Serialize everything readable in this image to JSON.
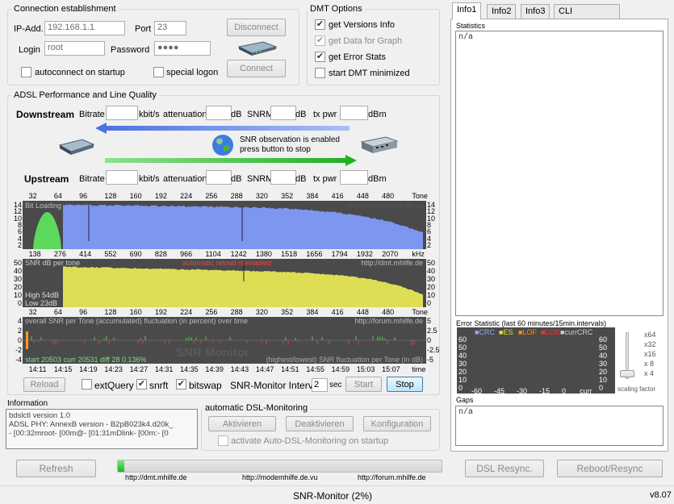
{
  "connection": {
    "title": "Connection establishment",
    "ip_label": "IP-Add.",
    "ip_value": "192.168.1.1",
    "port_label": "Port",
    "port_value": "23",
    "login_label": "Login",
    "login_value": "root",
    "password_label": "Password",
    "password_value": "●●●●",
    "disconnect": "Disconnect",
    "connect": "Connect",
    "autoconnect": "autoconnect on startup",
    "special": "special logon"
  },
  "dmt": {
    "title": "DMT Options",
    "opt1": "get Versions Info",
    "opt2": "get Data for Graph",
    "opt3": "get Error Stats",
    "opt4": "start DMT minimized"
  },
  "adsl": {
    "title": "ADSL Performance and Line Quality",
    "downstream": "Downstream",
    "upstream": "Upstream",
    "bitrate": "Bitrate",
    "kbits": "kbit/s",
    "attenuation": "attenuation",
    "db": "dB",
    "snrm": "SNRM",
    "txpwr": "tx pwr",
    "dbm": "dBm",
    "snr_msg1": "SNR observation is enabled",
    "snr_msg2": "press button to stop"
  },
  "graph1": {
    "tones": [
      "32",
      "64",
      "96",
      "128",
      "160",
      "192",
      "224",
      "256",
      "288",
      "320",
      "352",
      "384",
      "416",
      "448",
      "480",
      "Tone"
    ],
    "yticks": [
      "14",
      "12",
      "10",
      "8",
      "6",
      "4",
      "2"
    ],
    "label": "Bit Loading",
    "watermark": "http://modemhilfe.de.vu",
    "khz": [
      "138",
      "276",
      "414",
      "552",
      "690",
      "828",
      "966",
      "1104",
      "1242",
      "1380",
      "1518",
      "1656",
      "1794",
      "1932",
      "2070",
      "kHz"
    ]
  },
  "graph2": {
    "yticks": [
      "50",
      "40",
      "30",
      "20",
      "10",
      "0"
    ],
    "label": "SNR  dB per tone",
    "reload_msg": "automatic reload is enabled",
    "watermark": "http://dmt.mhilfe.de",
    "high": "High 54dB",
    "low": "Low  23dB",
    "tones": [
      "32",
      "64",
      "96",
      "128",
      "160",
      "192",
      "224",
      "256",
      "288",
      "320",
      "352",
      "384",
      "416",
      "448",
      "480",
      "Tone"
    ]
  },
  "graph3": {
    "title": "overall SNR per Tone (accumulated) fluctuation (in percent) over time",
    "watermark": "http://forum.mhilfe.de",
    "left_ticks": [
      "4",
      "2",
      "0",
      "-2",
      "-4"
    ],
    "right_ticks": [
      "5",
      "2.5",
      "0",
      "-2.5",
      "-5"
    ],
    "start_info": "start 20503  curr 20531  diff  28      0.136%",
    "bottom_msg": "(highest/lowest) SNR fluctuation per Tone (in dB)",
    "brand": "SNR Monitor",
    "times": [
      "14:11",
      "14:15",
      "14:19",
      "14:23",
      "14:27",
      "14:31",
      "14:35",
      "14:39",
      "14:43",
      "14:47",
      "14:51",
      "14:55",
      "14:59",
      "15:03",
      "15:07",
      "time"
    ]
  },
  "controls": {
    "reload": "Reload",
    "extquery": "extQuery",
    "snrft": "snrft",
    "bitswap": "bitswap",
    "interval_label": "SNR-Monitor Interval:",
    "interval_value": "2",
    "sec": "sec",
    "start": "Start",
    "stop": "Stop"
  },
  "info": {
    "title": "Information",
    "lines": [
      "bdslctl version 1.0",
      "ADSL PHY: AnnexB version - B2pB023k4.d20k_",
      "- [00:32mroot- [00m@- [01:31mDlink- [00m:- [0"
    ]
  },
  "auto": {
    "title": "automatic DSL-Monitoring",
    "activate": "Aktivieren",
    "deactivate": "Deaktivieren",
    "config": "Konfiguration",
    "startup": "activate Auto-DSL-Monitoring on startup"
  },
  "bottom": {
    "refresh": "Refresh",
    "dsl_resync": "DSL Resync.",
    "reboot": "Reboot/Resync",
    "link1": "http://dmt.mhilfe.de",
    "link2": "http://modemhilfe.de.vu",
    "link3": "http://forum.mhilfe.de",
    "progress": 0.02
  },
  "tabs": [
    "Info1",
    "Info2",
    "Info3",
    "CLI"
  ],
  "right": {
    "statistics": "Statistics",
    "stats_value": "n/a",
    "err_title": "Error Statistic (last 60 minutes/15min.intervals)",
    "legend": [
      "CRC",
      "ES",
      "LOF",
      "LOS",
      "currCRC"
    ],
    "err_yticks": [
      "60",
      "50",
      "40",
      "30",
      "20",
      "10",
      "0"
    ],
    "err_xticks": [
      "-60",
      "-45",
      "-30",
      "-15",
      "0",
      "curr"
    ],
    "scale_items": [
      "x64",
      "x32",
      "x16",
      "x 8",
      "x 4"
    ],
    "scaling": "scaling factor",
    "gaps": "Gaps",
    "gaps_value": "n/a"
  },
  "status": {
    "text": "SNR-Monitor (2%)",
    "version": "v8.07"
  },
  "colors": {
    "bitload": "#7d96f0",
    "upstream_green": "#5cd85c",
    "snr": "#dede55",
    "plotbg": "#4a4a4a"
  }
}
